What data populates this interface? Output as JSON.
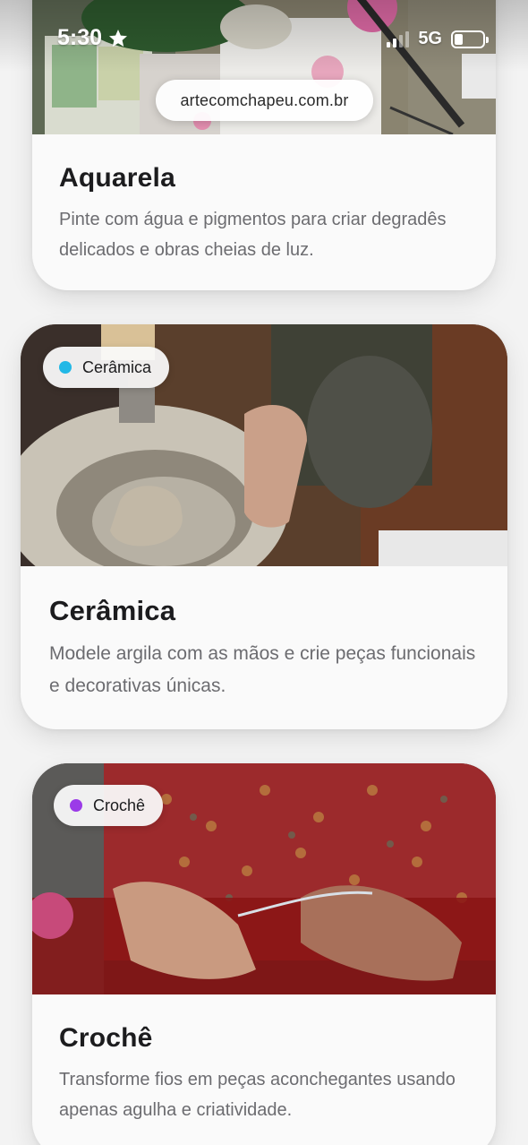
{
  "status_bar": {
    "time": "5:30",
    "network": "5G",
    "battery_percent": 30,
    "icons": [
      "star-icon",
      "signal-icon",
      "battery-icon"
    ]
  },
  "browser": {
    "url": "artecomchapeu.com.br"
  },
  "cards": [
    {
      "title": "Aquarela",
      "description": "Pinte com água e pigmentos para criar degradês delicados e obras cheias de luz."
    },
    {
      "tag": "Cerâmica",
      "tag_color": "#22b8e6",
      "title": "Cerâmica",
      "description": "Modele argila com as mãos e crie peças funcionais e decorativas únicas."
    },
    {
      "tag": "Crochê",
      "tag_color": "#9b3be8",
      "title": "Crochê",
      "description": "Transforme fios em peças aconchegantes usando apenas agulha e criatividade."
    }
  ],
  "colors": {
    "page_background": "#f3f3f3",
    "card_background": "#fafafa",
    "title": "#1c1c1e",
    "description": "#6c6c70"
  }
}
